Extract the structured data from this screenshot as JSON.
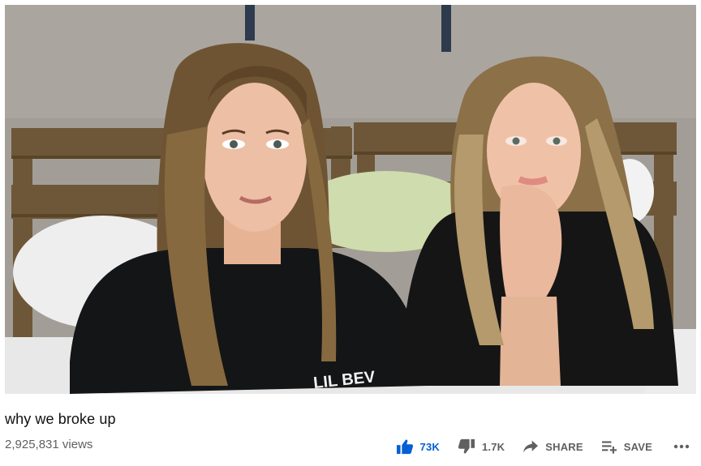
{
  "video": {
    "title": "why we broke up",
    "views": "2,925,831 views",
    "shirt_text": "LIL BEV"
  },
  "actions": {
    "like_count": "73K",
    "dislike_count": "1.7K",
    "share_label": "SHARE",
    "save_label": "SAVE"
  },
  "icons": {
    "like": "thumb-up-icon",
    "dislike": "thumb-down-icon",
    "share": "share-arrow-icon",
    "save": "playlist-add-icon",
    "more": "more-horizontal-icon"
  },
  "colors": {
    "like_active": "#065fd4",
    "secondary_text": "#606060",
    "title_text": "#111111"
  }
}
